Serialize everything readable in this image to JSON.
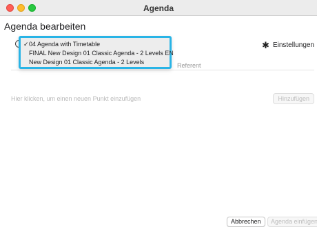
{
  "window": {
    "title": "Agenda"
  },
  "dialog": {
    "heading": "Agenda bearbeiten"
  },
  "settings": {
    "label": "Einstellungen",
    "icon": "gear-icon"
  },
  "agenda_select": {
    "icon": "clock-icon",
    "options": [
      {
        "label": "04 Agenda with Timetable",
        "selected": true
      },
      {
        "label": "FINAL New Design 01 Classic Agenda - 2 Levels EN",
        "selected": false
      },
      {
        "label": "New Design 01 Classic Agenda - 2 Levels",
        "selected": false
      }
    ],
    "check_glyph": "✓"
  },
  "table": {
    "columns": {
      "referent": "Referent"
    }
  },
  "add_item": {
    "placeholder": "Hier klicken, um einen neuen Punkt einzufügen",
    "add_label": "Hinzufügen"
  },
  "footer": {
    "cancel_label": "Abbrechen",
    "insert_label": "Agenda einfügen"
  },
  "colors": {
    "dropdown_highlight": "#29b4e6",
    "close": "#ff5f57",
    "minimize": "#febc2e",
    "maximize": "#28c840"
  }
}
